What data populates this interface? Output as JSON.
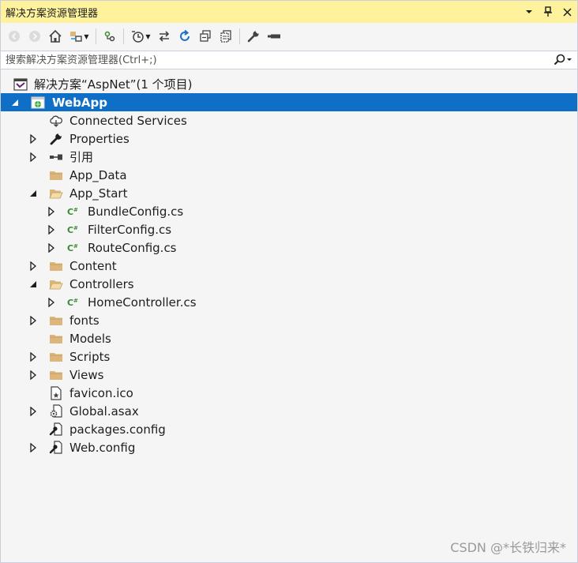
{
  "window": {
    "title": "解决方案资源管理器",
    "title_buttons": [
      "▾",
      "⊥",
      "✕"
    ]
  },
  "search": {
    "placeholder": "搜索解决方案资源管理器(Ctrl+;)"
  },
  "tree": {
    "solution": "解决方案“AspNet”(1 个项目)",
    "project": "WebApp",
    "items": [
      "Connected Services",
      "Properties",
      "引用",
      "App_Data",
      "App_Start",
      "BundleConfig.cs",
      "FilterConfig.cs",
      "RouteConfig.cs",
      "Content",
      "Controllers",
      "HomeController.cs",
      "fonts",
      "Models",
      "Scripts",
      "Views",
      "favicon.ico",
      "Global.asax",
      "packages.config",
      "Web.config"
    ]
  },
  "watermark": "CSDN @*长铁归来*",
  "colors": {
    "title_bg": "#fff29d",
    "selection": "#0f6fc6",
    "folder": "#dcb67a",
    "csharp": "#388a34"
  }
}
